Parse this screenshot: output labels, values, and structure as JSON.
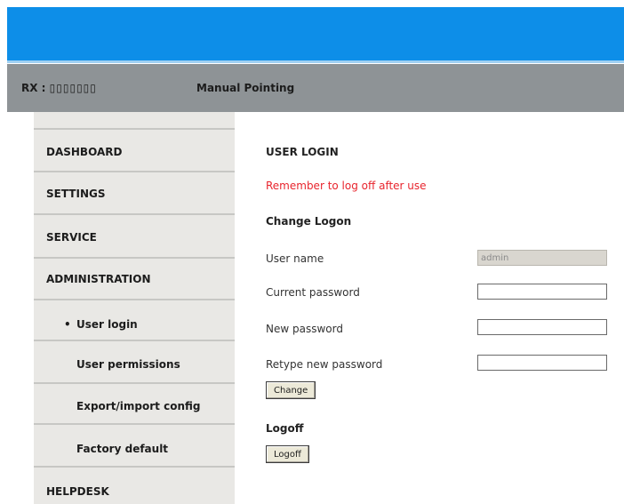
{
  "status": {
    "rx_label": "RX :",
    "rx_value": "▯▯▯▯▯▯▯",
    "mode": "Manual Pointing"
  },
  "sidebar": {
    "items": [
      {
        "label": "DASHBOARD"
      },
      {
        "label": "SETTINGS"
      },
      {
        "label": "SERVICE"
      },
      {
        "label": "ADMINISTRATION"
      },
      {
        "label": "User login",
        "bullet": "•"
      },
      {
        "label": "User permissions"
      },
      {
        "label": "Export/import config"
      },
      {
        "label": "Factory default"
      },
      {
        "label": "HELPDESK"
      }
    ]
  },
  "content": {
    "title": "USER LOGIN",
    "warning": "Remember to log off after use",
    "change_logon": {
      "heading": "Change Logon",
      "username_label": "User name",
      "username_value": "admin",
      "current_password_label": "Current password",
      "new_password_label": "New password",
      "retype_password_label": "Retype new password",
      "change_button": "Change"
    },
    "logoff": {
      "heading": "Logoff",
      "button": "Logoff"
    }
  },
  "colors": {
    "top_bar": "#0d8ee8",
    "status_bar": "#8e9396",
    "sidebar": "#e9e8e5",
    "warning": "#e8242d"
  }
}
